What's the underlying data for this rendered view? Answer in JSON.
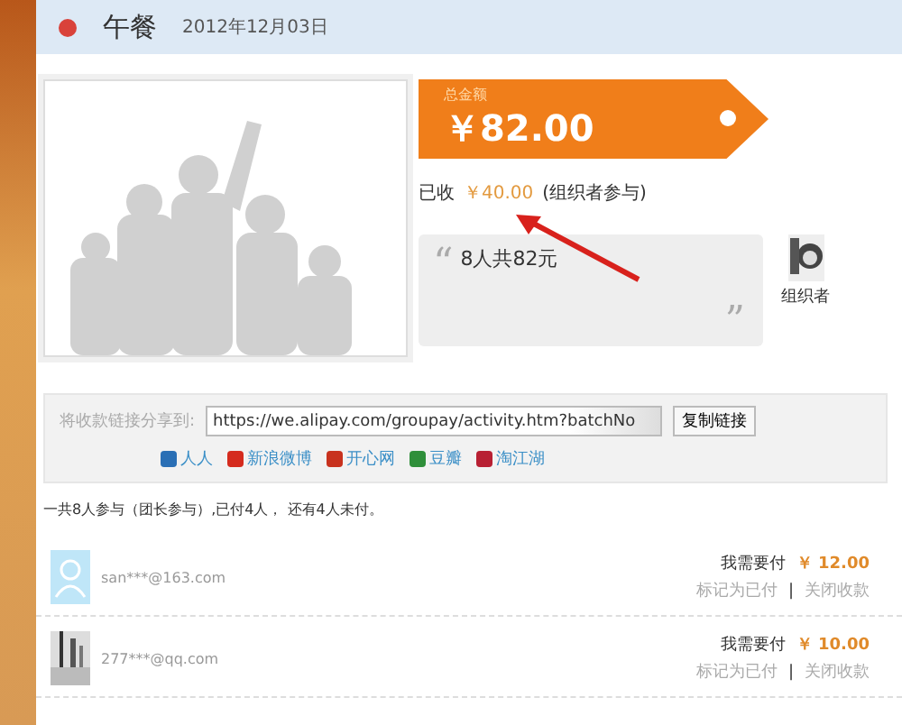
{
  "header": {
    "title": "午餐",
    "date": "2012年12月03日"
  },
  "total": {
    "label": "总金额",
    "amount": "￥82.00"
  },
  "received": {
    "label": "已收",
    "amount": "￥40.00",
    "note": "(组织者参与)"
  },
  "message": {
    "open_quote": "“",
    "text": "8人共82元",
    "close_quote": "”"
  },
  "organizer": {
    "label": "组织者"
  },
  "share": {
    "label": "将收款链接分享到:",
    "url": "https://we.alipay.com/groupay/activity.htm?batchNo",
    "copy_button": "复制链接",
    "sites": [
      {
        "name": "人人",
        "color": "#2a6fb5"
      },
      {
        "name": "新浪微博",
        "color": "#d52b1e"
      },
      {
        "name": "开心网",
        "color": "#c8321e"
      },
      {
        "name": "豆瓣",
        "color": "#2f8f3a"
      },
      {
        "name": "淘江湖",
        "color": "#b82033"
      }
    ]
  },
  "summary": "一共8人参与（团长参与）,已付4人， 还有4人未付。",
  "members": [
    {
      "kind": "default_avatar",
      "email": "san***@163.com",
      "due_label": "我需要付",
      "currency": "￥",
      "amount": "12.00",
      "mark_paid": "标记为已付",
      "separator": "|",
      "close": "关闭收款"
    },
    {
      "kind": "photo_avatar",
      "email": "277***@qq.com",
      "due_label": "我需要付",
      "currency": "￥",
      "amount": "10.00",
      "mark_paid": "标记为已付",
      "separator": "|",
      "close": "关闭收款"
    }
  ]
}
